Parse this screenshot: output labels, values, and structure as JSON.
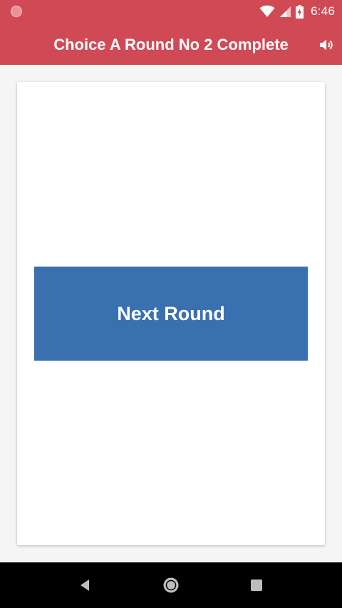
{
  "status_bar": {
    "time": "6:46",
    "icons": [
      "app-notification-icon",
      "wifi-icon",
      "cellular-signal-icon",
      "battery-charging-icon"
    ]
  },
  "header": {
    "title": "Choice A Round No 2 Complete",
    "action_icon": "volume-icon",
    "color": "#d04a55"
  },
  "main": {
    "next_button_label": "Next Round",
    "next_button_color": "#3971b0"
  },
  "nav_bar": {
    "buttons": [
      "back-icon",
      "home-icon",
      "recents-icon"
    ]
  }
}
